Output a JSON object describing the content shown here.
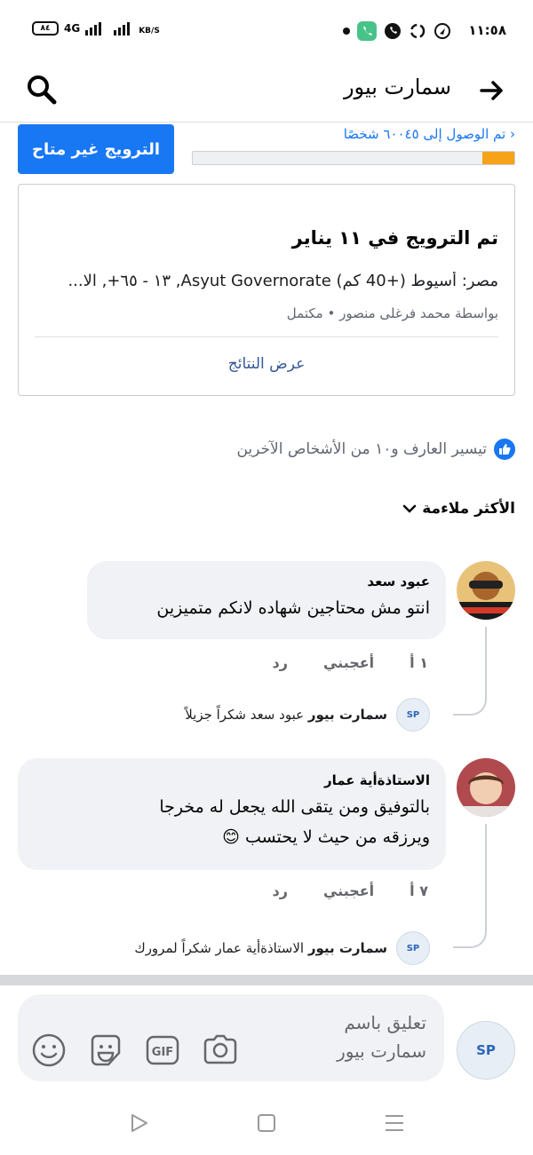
{
  "status_bar": {
    "time": "١١:٥٨",
    "battery": "٨٤",
    "network": "4G",
    "speed_unit": "KB/S"
  },
  "header": {
    "title": "سمارت بيور",
    "back_icon": "arrow-right-icon",
    "search_icon": "search-icon"
  },
  "promotion": {
    "button_label": "الترويج غير متاح",
    "reach_text": "تم الوصول إلى ٦٠٠٤٥ شخصًا",
    "progress_fraction": 0.1,
    "progress_color": "#f7a31a"
  },
  "promo_card": {
    "title": "تم الترويج في ١١ يناير",
    "targeting": "مصر: أسيوط (+40 كم) Asyut Governorate, ١٣ - ٦٥+, الا...",
    "by_line": "بواسطة محمد فرغلى منصور",
    "status": "مكتمل",
    "view_results": "عرض النتائج"
  },
  "reactions": {
    "text": "تيسير العارف و١٠ من الأشخاص الآخرين",
    "icon": "like-icon"
  },
  "sort": {
    "label": "الأكثر ملاءمة"
  },
  "comments": [
    {
      "author": "عبود سعد",
      "text": "انتو مش محتاجين شهاده لانكم متميزين",
      "like_count": "١ أ",
      "like_label": "أعجبني",
      "reply_label": "رد",
      "reply": {
        "author": "سمارت بيور",
        "text": "عبود سعد شكراً جزيلاً"
      }
    },
    {
      "author": "الاستاذةأية عمار",
      "text_line1": "بالتوفيق ومن يتقى الله يجعل له مخرجا",
      "text_line2": "ويرزقه من حيث لا يحتسب",
      "emoji": "😊",
      "like_count": "٧ أ",
      "like_label": "أعجبني",
      "reply_label": "رد",
      "reply": {
        "author": "سمارت بيور",
        "text": "الاستاذةأية عمار شكراً لمرورك"
      }
    }
  ],
  "composer": {
    "placeholder_line1": "تعليق باسم",
    "placeholder_line2": "سمارت بيور",
    "icons": [
      "camera-icon",
      "gif-icon",
      "sticker-icon",
      "emoji-icon"
    ]
  },
  "nav_bar": {
    "icons": [
      "menu-icon",
      "home-square-icon",
      "back-triangle-icon"
    ]
  }
}
